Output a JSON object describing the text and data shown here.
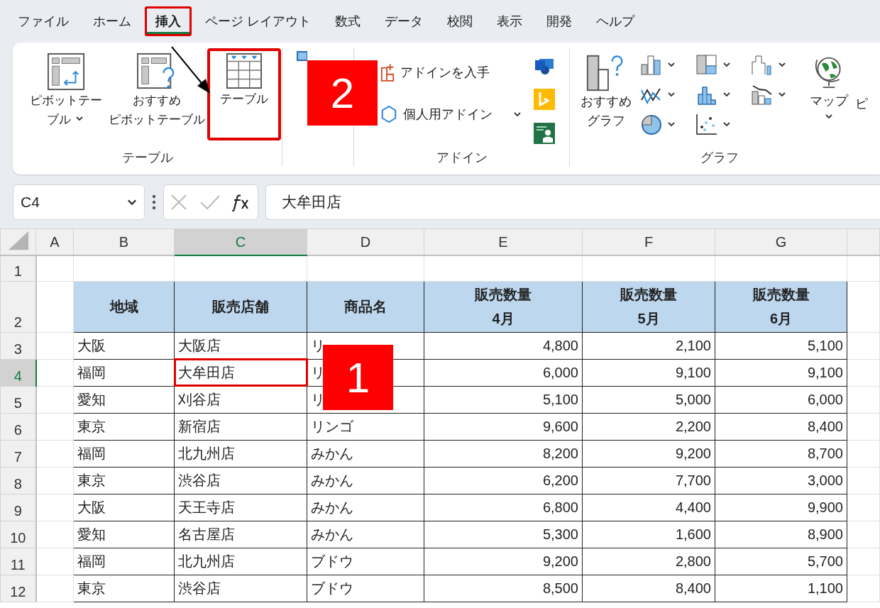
{
  "tabs": [
    {
      "label": "ファイル",
      "selected": false,
      "annotated": false
    },
    {
      "label": "ホーム",
      "selected": false,
      "annotated": false
    },
    {
      "label": "挿入",
      "selected": true,
      "annotated": true
    },
    {
      "label": "ページ レイアウト",
      "selected": false,
      "annotated": false
    },
    {
      "label": "数式",
      "selected": false,
      "annotated": false
    },
    {
      "label": "データ",
      "selected": false,
      "annotated": false
    },
    {
      "label": "校閲",
      "selected": false,
      "annotated": false
    },
    {
      "label": "表示",
      "selected": false,
      "annotated": false
    },
    {
      "label": "開発",
      "selected": false,
      "annotated": false
    },
    {
      "label": "ヘルプ",
      "selected": false,
      "annotated": false
    }
  ],
  "ribbon": {
    "table_group": {
      "label": "テーブル",
      "buttons": [
        {
          "lines": [
            "ピボットテー",
            "ブル"
          ],
          "menu": true,
          "annotated": false
        },
        {
          "lines": [
            "おすすめ",
            "ピボットテーブル"
          ],
          "menu": false,
          "annotated": false
        },
        {
          "lines": [
            "テーブル"
          ],
          "menu": false,
          "annotated": true
        }
      ]
    },
    "addin_group": {
      "label": "アドイン",
      "buttons": [
        {
          "label": "アドインを入手",
          "menu": false
        },
        {
          "label": "個人用アドイン",
          "menu": true
        }
      ]
    },
    "chart_group": {
      "label": "グラフ",
      "recommended": [
        "おすすめ",
        "グラフ"
      ],
      "map": "マップ",
      "cut_label": "ピ"
    }
  },
  "formula_bar": {
    "name_box": "C4",
    "formula": "大牟田店"
  },
  "sheet": {
    "columns": [
      {
        "label": "A",
        "selected": false
      },
      {
        "label": "B",
        "selected": false
      },
      {
        "label": "C",
        "selected": true
      },
      {
        "label": "D",
        "selected": false
      },
      {
        "label": "E",
        "selected": false
      },
      {
        "label": "F",
        "selected": false
      },
      {
        "label": "G",
        "selected": false
      }
    ],
    "rows": [
      {
        "number": "1",
        "kind": "blank",
        "selected": false
      },
      {
        "number": "2",
        "kind": "header",
        "selected": false,
        "cells": [
          [
            "地域"
          ],
          [
            "販売店舗"
          ],
          [
            "商品名"
          ],
          [
            "販売数量",
            "4月"
          ],
          [
            "販売数量",
            "5月"
          ],
          [
            "販売数量",
            "6月"
          ]
        ]
      },
      {
        "number": "3",
        "kind": "data",
        "selected": false,
        "annotated": false,
        "cells": [
          "大阪",
          "大阪店",
          "リ",
          "4,800",
          "2,100",
          "5,100"
        ]
      },
      {
        "number": "4",
        "kind": "data",
        "selected": true,
        "annotated": true,
        "cells": [
          "福岡",
          "大牟田店",
          "リ",
          "6,000",
          "9,100",
          "9,100"
        ]
      },
      {
        "number": "5",
        "kind": "data",
        "selected": false,
        "annotated": false,
        "cells": [
          "愛知",
          "刈谷店",
          "リ",
          "5,100",
          "5,000",
          "6,000"
        ]
      },
      {
        "number": "6",
        "kind": "data",
        "selected": false,
        "annotated": false,
        "cells": [
          "東京",
          "新宿店",
          "リンゴ",
          "9,600",
          "2,200",
          "8,400"
        ]
      },
      {
        "number": "7",
        "kind": "data",
        "selected": false,
        "annotated": false,
        "cells": [
          "福岡",
          "北九州店",
          "みかん",
          "8,200",
          "9,200",
          "8,700"
        ]
      },
      {
        "number": "8",
        "kind": "data",
        "selected": false,
        "annotated": false,
        "cells": [
          "東京",
          "渋谷店",
          "みかん",
          "6,200",
          "7,700",
          "3,000"
        ]
      },
      {
        "number": "9",
        "kind": "data",
        "selected": false,
        "annotated": false,
        "cells": [
          "大阪",
          "天王寺店",
          "みかん",
          "6,800",
          "4,400",
          "9,900"
        ]
      },
      {
        "number": "10",
        "kind": "data",
        "selected": false,
        "annotated": false,
        "cells": [
          "愛知",
          "名古屋店",
          "みかん",
          "5,300",
          "1,600",
          "8,900"
        ]
      },
      {
        "number": "11",
        "kind": "data",
        "selected": false,
        "annotated": false,
        "cells": [
          "福岡",
          "北九州店",
          "ブドウ",
          "9,200",
          "2,800",
          "5,700"
        ]
      },
      {
        "number": "12",
        "kind": "data",
        "selected": false,
        "annotated": false,
        "cells": [
          "東京",
          "渋谷店",
          "ブドウ",
          "8,500",
          "8,400",
          "1,100"
        ]
      }
    ]
  },
  "callouts": [
    {
      "label": "1"
    },
    {
      "label": "2"
    }
  ]
}
